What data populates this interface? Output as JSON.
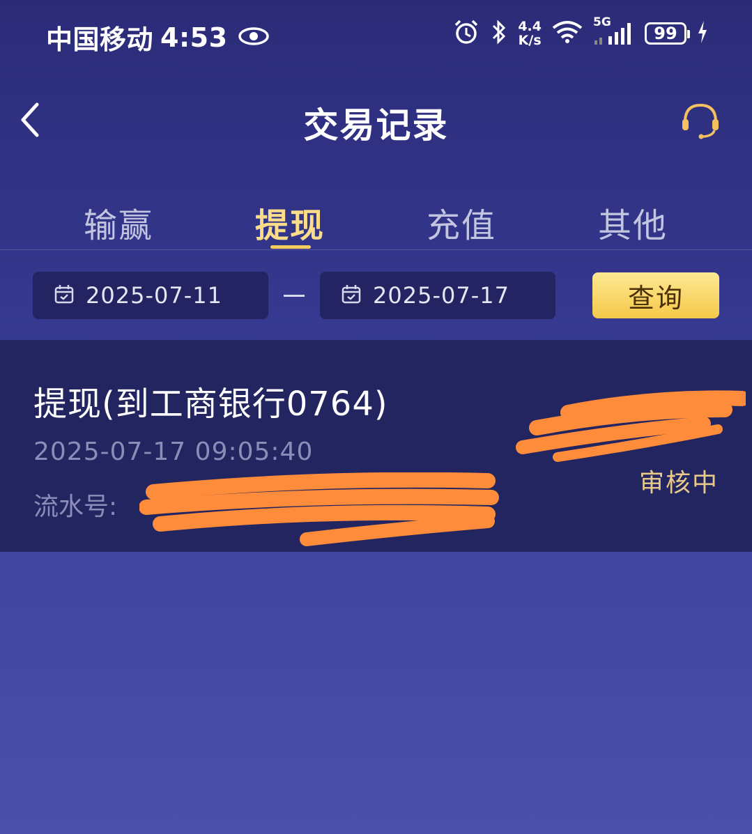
{
  "status_bar": {
    "carrier": "中国移动",
    "time": "4:53",
    "net_speed_value": "4.4",
    "net_speed_unit": "K/s",
    "network": "5G",
    "battery": "99",
    "icons": [
      "eye-icon",
      "alarm-icon",
      "bluetooth-icon",
      "wifi-icon",
      "signal-icon",
      "battery-icon",
      "charging-icon"
    ]
  },
  "header": {
    "title": "交易记录",
    "back_icon": "chevron-left-icon",
    "support_icon": "headset-icon"
  },
  "tabs": [
    {
      "label": "输赢",
      "active": false
    },
    {
      "label": "提现",
      "active": true
    },
    {
      "label": "充值",
      "active": false
    },
    {
      "label": "其他",
      "active": false
    }
  ],
  "filter": {
    "start_date": "2025-07-11",
    "end_date": "2025-07-17",
    "query_label": "查询"
  },
  "records": [
    {
      "title": "提现(到工商银行0764)",
      "time": "2025-07-17 09:05:40",
      "serial_label": "流水号: ",
      "status": "审核中"
    }
  ],
  "colors": {
    "background_top": "#2b2b78",
    "background_bottom": "#4a50a8",
    "accent_gold": "#f5cc5e",
    "record_bg": "#232560",
    "redaction": "#ff8c3a"
  }
}
